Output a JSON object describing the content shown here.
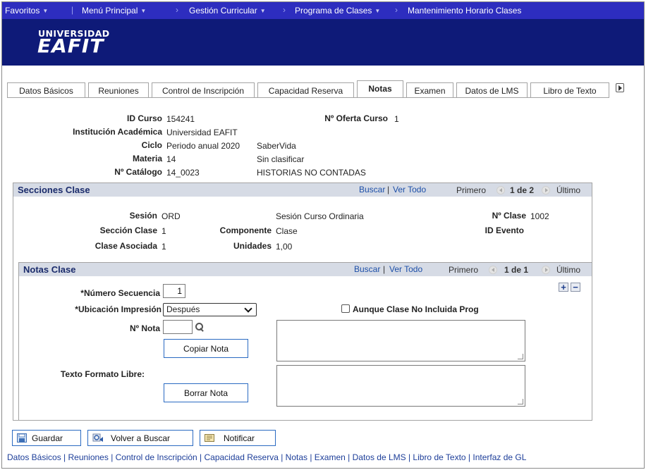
{
  "nav": {
    "favoritos": "Favoritos",
    "menu_principal": "Menú Principal",
    "crumb1": "Gestión Curricular",
    "crumb2": "Programa de Clases",
    "crumb3": "Mantenimiento Horario Clases"
  },
  "logo": {
    "top": "UNIVERSIDAD",
    "main": "EAFIT"
  },
  "tabs": [
    {
      "label": "Datos Básicos"
    },
    {
      "label": "Reuniones"
    },
    {
      "label": "Control de Inscripción"
    },
    {
      "label": "Capacidad Reserva"
    },
    {
      "label": "Notas"
    },
    {
      "label": "Examen"
    },
    {
      "label": "Datos de LMS"
    },
    {
      "label": "Libro de Texto"
    }
  ],
  "header": {
    "id_curso_label": "ID Curso",
    "id_curso": "154241",
    "oferta_label": "Nº Oferta Curso",
    "oferta": "1",
    "institucion_label": "Institución Académica",
    "institucion": "Universidad EAFIT",
    "ciclo_label": "Ciclo",
    "ciclo": "Periodo anual 2020",
    "ciclo_desc": "SaberVida",
    "materia_label": "Materia",
    "materia": "14",
    "materia_desc": "Sin clasificar",
    "catalogo_label": "Nº Catálogo",
    "catalogo": "14_0023",
    "catalogo_desc": "HISTORIAS NO CONTADAS"
  },
  "secciones": {
    "title": "Secciones Clase",
    "buscar": "Buscar",
    "ver_todo": "Ver Todo",
    "primero": "Primero",
    "pager": "1 de 2",
    "ultimo": "Último",
    "sesion_label": "Sesión",
    "sesion": "ORD",
    "sesion_desc": "Sesión Curso Ordinaria",
    "nclase_label": "Nº Clase",
    "nclase": "1002",
    "seccion_label": "Sección Clase",
    "seccion": "1",
    "componente_label": "Componente",
    "componente": "Clase",
    "evento_label": "ID Evento",
    "asociada_label": "Clase Asociada",
    "asociada": "1",
    "unidades_label": "Unidades",
    "unidades": "1,00"
  },
  "notas": {
    "title": "Notas Clase",
    "buscar": "Buscar",
    "ver_todo": "Ver Todo",
    "primero": "Primero",
    "pager": "1 de 1",
    "ultimo": "Último",
    "secuencia_label": "*Número Secuencia",
    "secuencia": "1",
    "ubicacion_label": "*Ubicación Impresión",
    "ubicacion": "Después",
    "aunque_label": "Aunque Clase No Incluida Prog",
    "nnota_label": "Nº Nota",
    "nnota": "",
    "copiar": "Copiar Nota",
    "texto_label": "Texto Formato Libre:",
    "borrar": "Borrar Nota"
  },
  "footer": {
    "guardar": "Guardar",
    "volver": "Volver a Buscar",
    "notificar": "Notificar",
    "links": "Datos Básicos | Reuniones | Control de Inscripción | Capacidad Reserva | Notas | Examen | Datos de LMS | Libro de Texto | Interfaz de GL"
  }
}
